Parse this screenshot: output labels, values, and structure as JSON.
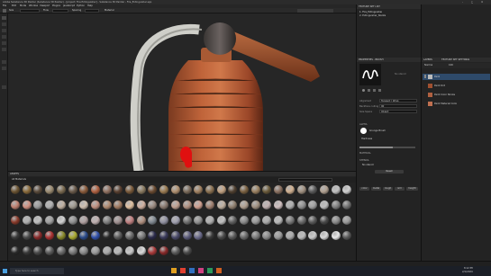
{
  "window": {
    "title": "Adobe Substance 3D Painter (Substance 3D Painter) - [project: Fire Extinguisher] - Substance 3D Painter - Fire_Extinguisher.spp"
  },
  "menu": [
    "File",
    "Edit",
    "Mode",
    "Window",
    "Viewport",
    "Plugins",
    "JavaScript",
    "Python",
    "Help"
  ],
  "toolbar": {
    "size_label": "Size",
    "flow_label": "Flow",
    "spacing_label": "Spacing",
    "material_label": "Material"
  },
  "texture_set": {
    "header": "TEXTURE SET LIST",
    "items": [
      "1. Fire_Extinguisher",
      "2. Extinguisher_Nozzle"
    ]
  },
  "properties": {
    "header": "PROPERTIES - BRUSH",
    "stroke_preview_label": "No stencil",
    "fields": [
      {
        "label": "Alignment",
        "value": "Tangent | Wrap"
      },
      {
        "label": "Backface culling",
        "value": "90"
      },
      {
        "label": "Size Space",
        "value": "Object"
      }
    ],
    "alpha_header": "ALPHA",
    "alpha_name": "Grunge Brush",
    "checkbox_hardness": "Hardness",
    "section_material": "MATERIAL",
    "section_stencil": "STENCIL",
    "stencil_value": "No stencil",
    "reset_label": "Reset",
    "buttons": [
      "color",
      "metal",
      "rough",
      "nrm",
      "height"
    ]
  },
  "layers": {
    "header": "LAYERS",
    "tab2": "TEXTURE SET SETTINGS",
    "blend": "Normal",
    "opacity": "100",
    "rows": [
      "Paint",
      "Paint Dirt",
      "Paint Color Stroke",
      "Paint Material Color"
    ]
  },
  "assets": {
    "header": "ASSETS",
    "filter": "All Materials",
    "search_placeholder": "Search",
    "rows": [
      [
        "#6b5432",
        "#8a6a3a",
        "#5a4a3a",
        "#9a8a70",
        "#7a6a50",
        "#6a5a4a",
        "#8a5a3a",
        "#b06040",
        "#907060",
        "#5a4030",
        "#7a5a3a",
        "#8a7a60",
        "#6a4a30",
        "#9a7a50",
        "#b09070",
        "#7a6a5a",
        "#a08060",
        "#8a7050",
        "#c0a080",
        "#504030",
        "#7a6040",
        "#9a8060",
        "#6a5a3a",
        "#8a7060",
        "#d0b090",
        "#a09080",
        "#5a5a5a",
        "#b0a090",
        "#c0c0c0",
        "#d0d0d0"
      ],
      [
        "#c08070",
        "#d09080",
        "#9a9a9a",
        "#b0b0b0",
        "#c0b0a0",
        "#a09a90",
        "#d0c0b0",
        "#c09080",
        "#b08a70",
        "#a07a60",
        "#e0c0a0",
        "#d0b0a0",
        "#9a8a80",
        "#8a7a70",
        "#c0a090",
        "#b09080",
        "#d0a090",
        "#a08070",
        "#c0b0a0",
        "#908070",
        "#b0a090",
        "#a09080",
        "#c0b0b0",
        "#d0c0c0",
        "#b0b0b0",
        "#909090",
        "#a0a0a0",
        "#c0c0c0",
        "#808080",
        "#707070"
      ],
      [
        "#8a3a2a",
        "#b0b0b0",
        "#c0c0c0",
        "#a0a0a0",
        "#d0d0d0",
        "#909090",
        "#b0a0a0",
        "#c0b0b0",
        "#808080",
        "#a09090",
        "#c08080",
        "#b09080",
        "#808890",
        "#9090a0",
        "#a0a0b0",
        "#707070",
        "#909090",
        "#b0b0b0",
        "#c0c0c0",
        "#606060",
        "#8a8a8a",
        "#9a9a9a",
        "#aaaaaa",
        "#bababa",
        "#7a7a7a",
        "#6a6a6a",
        "#5a5a5a",
        "#4a4a4a",
        "#8a8a8a",
        "#9a9a9a"
      ],
      [
        "#3a3a3a",
        "#4a4a4a",
        "#8a2a2a",
        "#aa3030",
        "#8a8a2a",
        "#aaaa30",
        "#2a4a8a",
        "#3050aa",
        "#2a2a2a",
        "#5a5a5a",
        "#6a6a6a",
        "#7a7a7a",
        "#2a2a4a",
        "#3a3a5a",
        "#4a4a6a",
        "#5a5a7a",
        "#6a6a8a",
        "#3a3a3a",
        "#4a4a4a",
        "#5a5a5a",
        "#6a6a6a",
        "#7a7a7a",
        "#8a8a8a",
        "#9a9a9a",
        "#aaaaaa",
        "#bababa",
        "#cacaca",
        "#dadada",
        "#eaeaea",
        "#5a5a5a"
      ],
      [
        "#2a2a2a",
        "#3a3a3a",
        "#4a4a4a",
        "#5a5a5a",
        "#6a6a6a",
        "#7a7a7a",
        "#8a8a8a",
        "#9a9a9a",
        "#aaaaaa",
        "#bababa",
        "#cacaca",
        "#dadada",
        "#aa3a3a",
        "#8a2a2a",
        "#5a5a5a",
        "#4a4a4a"
      ]
    ]
  },
  "status": {
    "left": "",
    "right": ""
  },
  "taskbar": {
    "search_placeholder": "Type here to search",
    "time": "8:12 PM",
    "date": "2/1/2024"
  }
}
